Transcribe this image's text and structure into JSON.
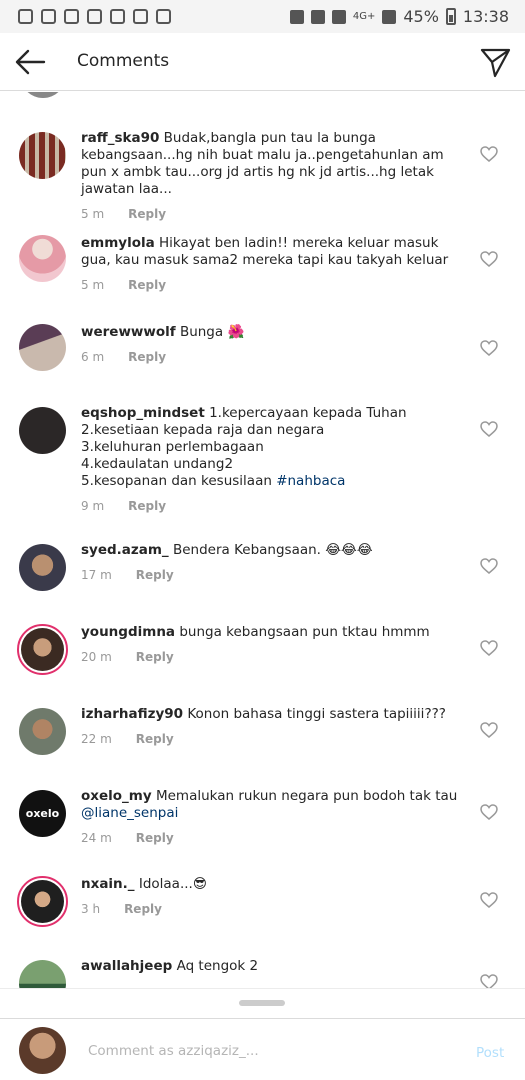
{
  "status_bar": {
    "network": "4G+",
    "battery": "45%",
    "time": "13:38"
  },
  "header": {
    "title": "Comments"
  },
  "comments": [
    {
      "username": "raff_ska90",
      "text": "Budak,bangla pun tau la bunga kebangsaan...hg nih buat malu ja..pengetahunlan am pun x ambk tau...org jd artis hg nk jd artis...hg letak jawatan laa...",
      "time": "5 m",
      "reply": "Reply"
    },
    {
      "username": "emmylola",
      "text": "Hikayat ben ladin!! mereka keluar masuk gua, kau masuk sama2 mereka tapi kau takyah keluar",
      "time": "5 m",
      "reply": "Reply"
    },
    {
      "username": "werewwwolf",
      "text": "Bunga 🌺",
      "time": "6 m",
      "reply": "Reply"
    },
    {
      "username": "eqshop_mindset",
      "text": "1.kepercayaan kepada Tuhan",
      "lines": [
        "2.kesetiaan kepada raja dan negara",
        "3.keluhuran perlembagaan",
        "4.kedaulatan undang2",
        "5.kesopanan dan kesusilaan "
      ],
      "hashtag": "#nahbaca",
      "time": "9 m",
      "reply": "Reply"
    },
    {
      "username": "syed.azam_",
      "text": "Bendera Kebangsaan. 😂😂😂",
      "time": "17 m",
      "reply": "Reply"
    },
    {
      "username": "youngdimna",
      "text": "bunga kebangsaan pun tktau hmmm",
      "time": "20 m",
      "reply": "Reply"
    },
    {
      "username": "izharhafizy90",
      "text": "Konon bahasa tinggi sastera tapiiiii???",
      "time": "22 m",
      "reply": "Reply"
    },
    {
      "username": "oxelo_my",
      "text": "Memalukan rukun negara pun bodoh tak tau ",
      "mention": "@liane_senpai",
      "time": "24 m",
      "reply": "Reply"
    },
    {
      "username": "nxain._",
      "text": "Idolaa...😎",
      "time": "3 h",
      "reply": "Reply"
    },
    {
      "username": "awallahjeep",
      "text": "Aq tengok 2",
      "time": "",
      "reply": ""
    }
  ],
  "avatar_logo_text": "oxelo",
  "compose": {
    "placeholder": "Comment as azziqaziz_...",
    "post_label": "Post"
  }
}
